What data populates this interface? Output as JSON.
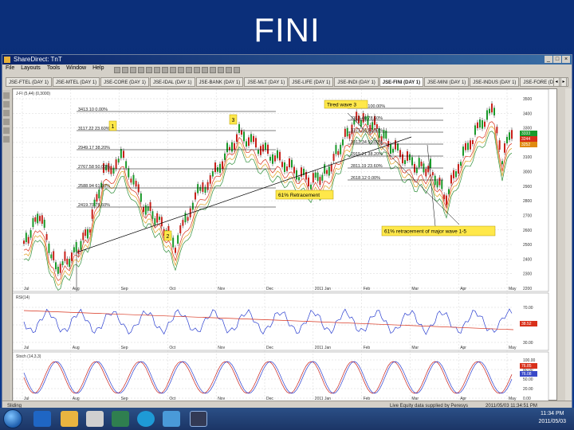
{
  "slide": {
    "title": "FINI"
  },
  "window": {
    "title": "ShareDirect: TnT",
    "menu": [
      "File",
      "Layouts",
      "Tools",
      "Window",
      "Help"
    ],
    "tabs": [
      "JSE-FTEL (DAY 1)",
      "JSE-MTEL (DAY 1)",
      "JSE-CORE (DAY 1)",
      "JSE-IDAL (DAY 1)",
      "JSE-BANK (DAY 1)",
      "JSE-MLT (DAY 1)",
      "JSE-LIFE (DAY 1)",
      "JSE-INDI (DAY 1)",
      "JSE-FINI (DAY 1)",
      "JSE-MINI (DAY 1)",
      "JSE-INDUS (DAY 1)",
      "JSE-FORE (DAY 1)"
    ],
    "active_tab_index": 8,
    "status_left": "Sliding",
    "status_mid": "Live Equity data supplied by Peresys",
    "status_right": "2011/05/03 11:34:51 PM"
  },
  "chart": {
    "header_price": "J-FI (5,44) (0,3000)",
    "header_osc1": "RSI(14)",
    "header_osc2": "Stoch (14,3,3)",
    "x_labels": [
      "Jul",
      "Aug",
      "Sep",
      "Oct",
      "Nov",
      "Dec",
      "2011 Jan",
      "Feb",
      "Mar",
      "Apr",
      "May"
    ],
    "y_labels_price": [
      "3500",
      "3400",
      "3300",
      "3200",
      "3100",
      "3000",
      "2900",
      "2800",
      "2700",
      "2600",
      "2500",
      "2400",
      "2300",
      "2200"
    ],
    "y_labels_osc1": [
      "70.00",
      "50.00",
      "30.00"
    ],
    "y_labels_osc2": [
      "100.00",
      "80.00",
      "50.00",
      "20.00",
      "0.00"
    ],
    "price_badges": [
      {
        "text": "3333",
        "color": "#1a9a2a"
      },
      {
        "text": "3244",
        "color": "#d8301a"
      },
      {
        "text": "3252",
        "color": "#e08a10"
      }
    ],
    "osc1_badge": {
      "text": "38.52",
      "color": "#d8301a"
    },
    "osc2_badges": [
      {
        "text": "76.85",
        "color": "#d8301a"
      },
      {
        "text": "76.08",
        "color": "#3a4ac8"
      }
    ],
    "fib_left": [
      "3413.10 0.00%",
      "3117.22 23.60%",
      "2949.17 38.20%",
      "2767.58 50.00%",
      "2588.94 61.80%",
      "2419.70 78.60%"
    ],
    "fib_right": [
      "3447.37 100.00%",
      "3313.40 78.60%",
      "3171.13 61.80%",
      "3013.34 50.00%",
      "2915.21 38.20%",
      "2811.19 23.60%",
      "2618.12 0.00%"
    ],
    "annotations": {
      "tired_wave": "Tired wave 3",
      "retracement_61": "61% Retracement",
      "major_retracement": "61% retracement of major wave 1-5",
      "wave1": "1",
      "wave2": "2",
      "wave3": "3"
    }
  },
  "taskbar": {
    "clock_time": "11:34 PM",
    "clock_date": "2011/05/03"
  }
}
